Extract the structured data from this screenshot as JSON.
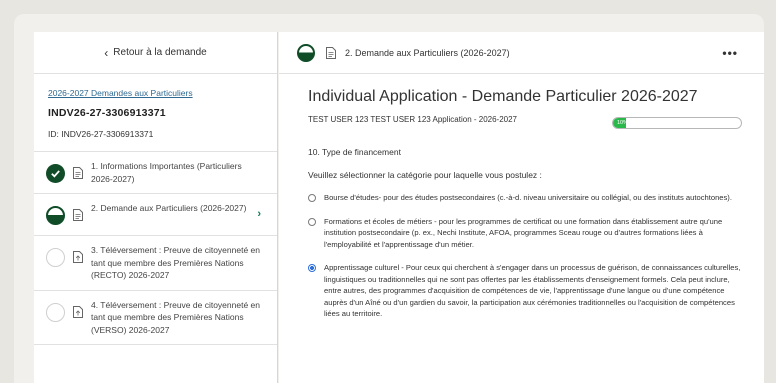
{
  "sidebar": {
    "back_label": "Retour à la demande",
    "application_link": "2026-2027 Demandes aux Particuliers",
    "application_number": "INDV26-27-3306913371",
    "id_line": "ID: INDV26-27-3306913371",
    "steps": [
      {
        "label": "1. Informations Importantes (Particuliers 2026-2027)",
        "status": "complete"
      },
      {
        "label": "2. Demande aux Particuliers (2026-2027)",
        "status": "in-progress"
      },
      {
        "label": "3. Téléversement : Preuve de citoyenneté en tant que membre des Premières Nations (RECTO) 2026-2027",
        "status": "not-started"
      },
      {
        "label": "4. Téléversement : Preuve de citoyenneté en tant que membre des Premières Nations (VERSO) 2026-2027",
        "status": "not-started"
      }
    ]
  },
  "header": {
    "title": "2. Demande aux Particuliers (2026-2027)",
    "more_label": "•••"
  },
  "main": {
    "heading": "Individual Application - Demande Particulier 2026-2027",
    "subheading": "TEST USER 123 TEST USER 123   Application - 2026-2027",
    "progress_percent": 10,
    "progress_label": "10%",
    "question_number": "10. Type de financement",
    "question_text": "Veuillez sélectionner la catégorie pour laquelle vous postulez :",
    "options": [
      {
        "text": "Bourse d'études- pour des études postsecondaires (c.-à-d. niveau universitaire ou collégial, ou des instituts autochtones).",
        "selected": false
      },
      {
        "text": "Formations et écoles de métiers - pour les programmes de certificat ou une formation dans établissement autre qu'une institution postsecondaire (p. ex., Nechi Institute, AFOA, programmes Sceau rouge ou d'autres formations liées à l'employabilité et l'apprentissage d'un métier.",
        "selected": false
      },
      {
        "text": "Apprentissage culturel - Pour ceux qui cherchent à s'engager dans un processus de guérison, de connaissances culturelles, linguistiques ou traditionnelles qui ne sont pas offertes par les établissements d'enseignement formels. Cela peut inclure, entre autres, des programmes d'acquisition de compétences de vie, l'apprentissage d'une langue ou d'une compétence auprès d'un Aîné ou d'un gardien du savoir, la participation aux cérémonies traditionnelles ou l'acquisition de compétences liées au territoire.",
        "selected": true
      }
    ]
  },
  "colors": {
    "accent": "#0f4c27",
    "progress": "#2bb84a",
    "radio_selected": "#2e6fdc",
    "link": "#2f6a92"
  }
}
